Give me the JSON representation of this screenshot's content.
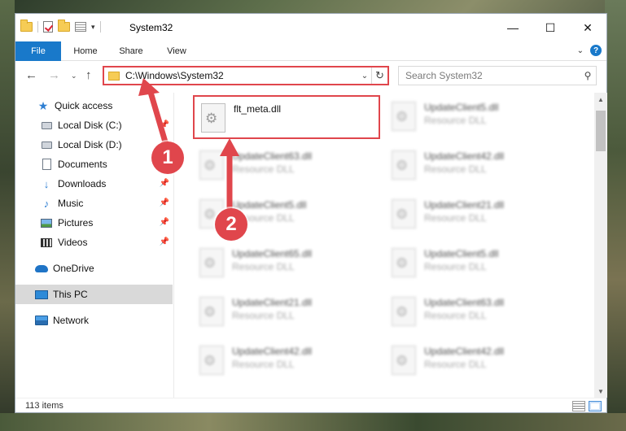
{
  "window": {
    "title": "System32",
    "controls": {
      "minimize": "—",
      "maximize": "☐",
      "close": "✕"
    }
  },
  "ribbon": {
    "tabs": [
      "File",
      "Home",
      "Share",
      "View"
    ],
    "help": "?"
  },
  "address": {
    "path": "C:\\Windows\\System32",
    "refresh": "↻",
    "dropdown": "⌄"
  },
  "search": {
    "placeholder": "Search System32",
    "icon": "search-icon"
  },
  "nav": {
    "back": "←",
    "forward": "→",
    "recent": "⌄",
    "up": "↑"
  },
  "sidebar": {
    "items": [
      {
        "label": "Quick access",
        "icon": "star-icon"
      },
      {
        "label": "Local Disk (C:)",
        "icon": "drive-icon",
        "pinned": true
      },
      {
        "label": "Local Disk (D:)",
        "icon": "drive-icon",
        "pinned": true
      },
      {
        "label": "Documents",
        "icon": "documents-icon",
        "pinned": true
      },
      {
        "label": "Downloads",
        "icon": "downloads-icon",
        "pinned": true
      },
      {
        "label": "Music",
        "icon": "music-icon",
        "pinned": true
      },
      {
        "label": "Pictures",
        "icon": "pictures-icon",
        "pinned": true
      },
      {
        "label": "Videos",
        "icon": "videos-icon",
        "pinned": true
      },
      {
        "label": "OneDrive",
        "icon": "onedrive-icon"
      },
      {
        "label": "This PC",
        "icon": "this-pc-icon",
        "selected": true
      },
      {
        "label": "Network",
        "icon": "network-icon"
      }
    ]
  },
  "files": [
    {
      "name": "flt_meta.dll",
      "type": "",
      "highlighted": true
    },
    {
      "name": "UpdateClient5.dll",
      "type": "Resource DLL"
    },
    {
      "name": "UpdateClient63.dll",
      "type": "Resource DLL"
    },
    {
      "name": "UpdateClient42.dll",
      "type": "Resource DLL"
    },
    {
      "name": "UpdateClient5.dll",
      "type": "Resource DLL"
    },
    {
      "name": "UpdateClient21.dll",
      "type": "Resource DLL"
    },
    {
      "name": "UpdateClient65.dll",
      "type": "Resource DLL"
    },
    {
      "name": "UpdateClient5.dll",
      "type": "Resource DLL"
    },
    {
      "name": "UpdateClient21.dll",
      "type": "Resource DLL"
    },
    {
      "name": "UpdateClient63.dll",
      "type": "Resource DLL"
    },
    {
      "name": "UpdateClient42.dll",
      "type": "Resource DLL"
    },
    {
      "name": "UpdateClient42.dll",
      "type": "Resource DLL"
    }
  ],
  "status": {
    "item_count": "113 items"
  },
  "annotations": [
    {
      "number": "1"
    },
    {
      "number": "2"
    }
  ],
  "colors": {
    "accent": "#1979ca",
    "annotation": "#e0464c",
    "selected": "#d9d9d9"
  }
}
